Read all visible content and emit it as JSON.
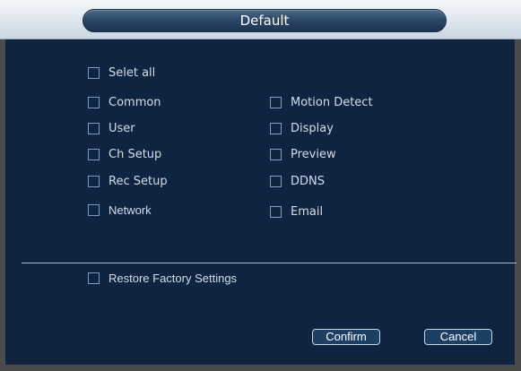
{
  "dialog": {
    "title": "Default"
  },
  "select_all": {
    "label": "Selet all",
    "checked": false
  },
  "left_options": [
    {
      "label": "Common",
      "checked": false
    },
    {
      "label": "User",
      "checked": false
    },
    {
      "label": "Ch Setup",
      "checked": false
    },
    {
      "label": "Rec Setup",
      "checked": false
    },
    {
      "label": "Network",
      "checked": false
    }
  ],
  "right_options": [
    {
      "label": "Motion Detect",
      "checked": false
    },
    {
      "label": "Display",
      "checked": false
    },
    {
      "label": "Preview",
      "checked": false
    },
    {
      "label": "DDNS",
      "checked": false
    },
    {
      "label": "Email",
      "checked": false
    }
  ],
  "restore": {
    "label": "Restore Factory Settings",
    "checked": false
  },
  "buttons": {
    "confirm": "Confirm",
    "cancel": "Cancel"
  }
}
